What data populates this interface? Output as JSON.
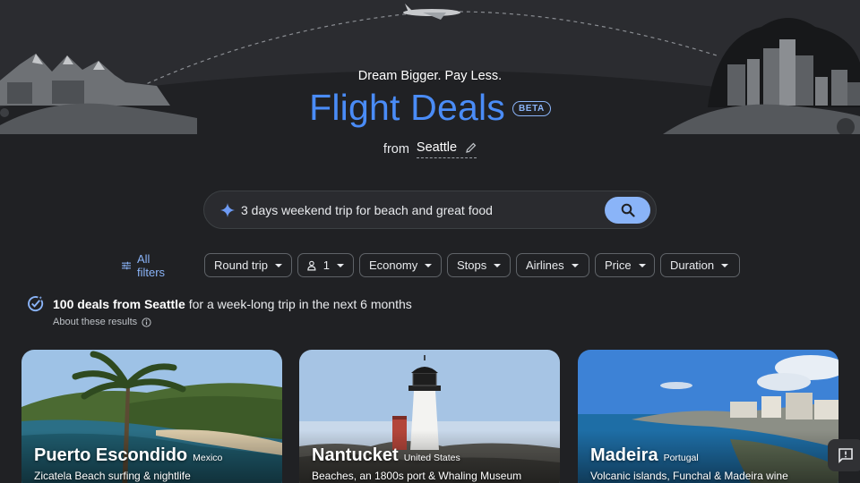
{
  "hero": {
    "tagline": "Dream Bigger. Pay Less.",
    "title": "Flight Deals",
    "badge": "BETA",
    "from_label": "from",
    "from_city": "Seattle"
  },
  "search": {
    "query": "3 days weekend trip for beach and great food",
    "icons": {
      "sparkle": "sparkle-icon",
      "submit": "search-icon"
    }
  },
  "filters": {
    "all_filters": "All filters",
    "chips": {
      "trip_type": "Round trip",
      "passengers": "1",
      "cabin": "Economy",
      "stops": "Stops",
      "airlines": "Airlines",
      "price": "Price",
      "duration": "Duration"
    }
  },
  "results": {
    "headline_bold": "100 deals from Seattle",
    "headline_rest": "for a week-long trip in the next 6 months",
    "about": "About these results"
  },
  "cards": [
    {
      "city": "Puerto Escondido",
      "country": "Mexico",
      "description": "Zicatela Beach surfing & nightlife"
    },
    {
      "city": "Nantucket",
      "country": "United States",
      "description": "Beaches, an 1800s port & Whaling Museum"
    },
    {
      "city": "Madeira",
      "country": "Portugal",
      "description": "Volcanic islands, Funchal & Madeira wine"
    }
  ],
  "colors": {
    "background": "#202124",
    "accent": "#8ab4f8",
    "title": "#4a8cf7",
    "chip_border": "#5f6368"
  }
}
